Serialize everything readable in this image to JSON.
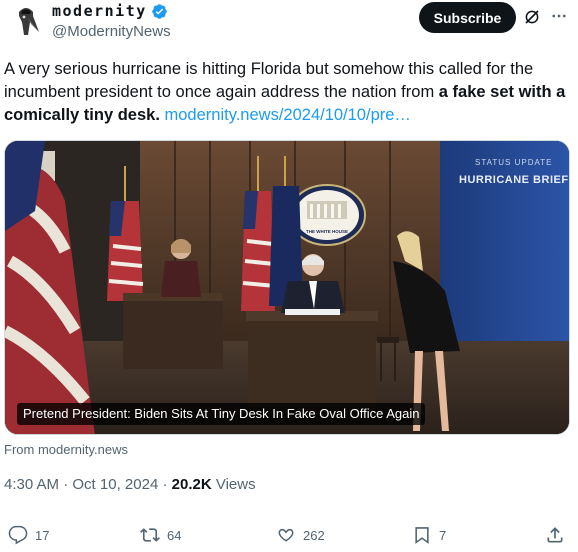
{
  "account": {
    "display_name": "modernity",
    "handle": "@ModernityNews",
    "verified": true,
    "verified_color": "#1d9bf0"
  },
  "header": {
    "subscribe_label": "Subscribe",
    "grok_icon": "grok-icon",
    "more_icon": "more-horizontal-icon"
  },
  "tweet": {
    "text_plain": "A very serious hurricane is hitting Florida but somehow this called for the incumbent president to once again address the nation from ",
    "text_bold": "a fake set with a comically tiny desk.",
    "link_text": "modernity.news/2024/10/10/pre…"
  },
  "media": {
    "sign_line1": "STATUS UPDATE",
    "sign_line2": "HURRICANE BRIEF",
    "seal_text": "THE WHITE HOUSE",
    "caption": "Pretend President: Biden Sits At Tiny Desk In Fake Oval Office Again"
  },
  "card": {
    "from_label": "From modernity.news"
  },
  "meta": {
    "time": "4:30 AM",
    "date": "Oct 10, 2024",
    "views_count": "20.2K",
    "views_label": "Views"
  },
  "actions": {
    "replies": "17",
    "reposts": "64",
    "likes": "262",
    "bookmarks": "7"
  },
  "colors": {
    "text_primary": "#0f1419",
    "text_secondary": "#536471",
    "link": "#1d9bf0",
    "button_dark": "#0f1419"
  }
}
